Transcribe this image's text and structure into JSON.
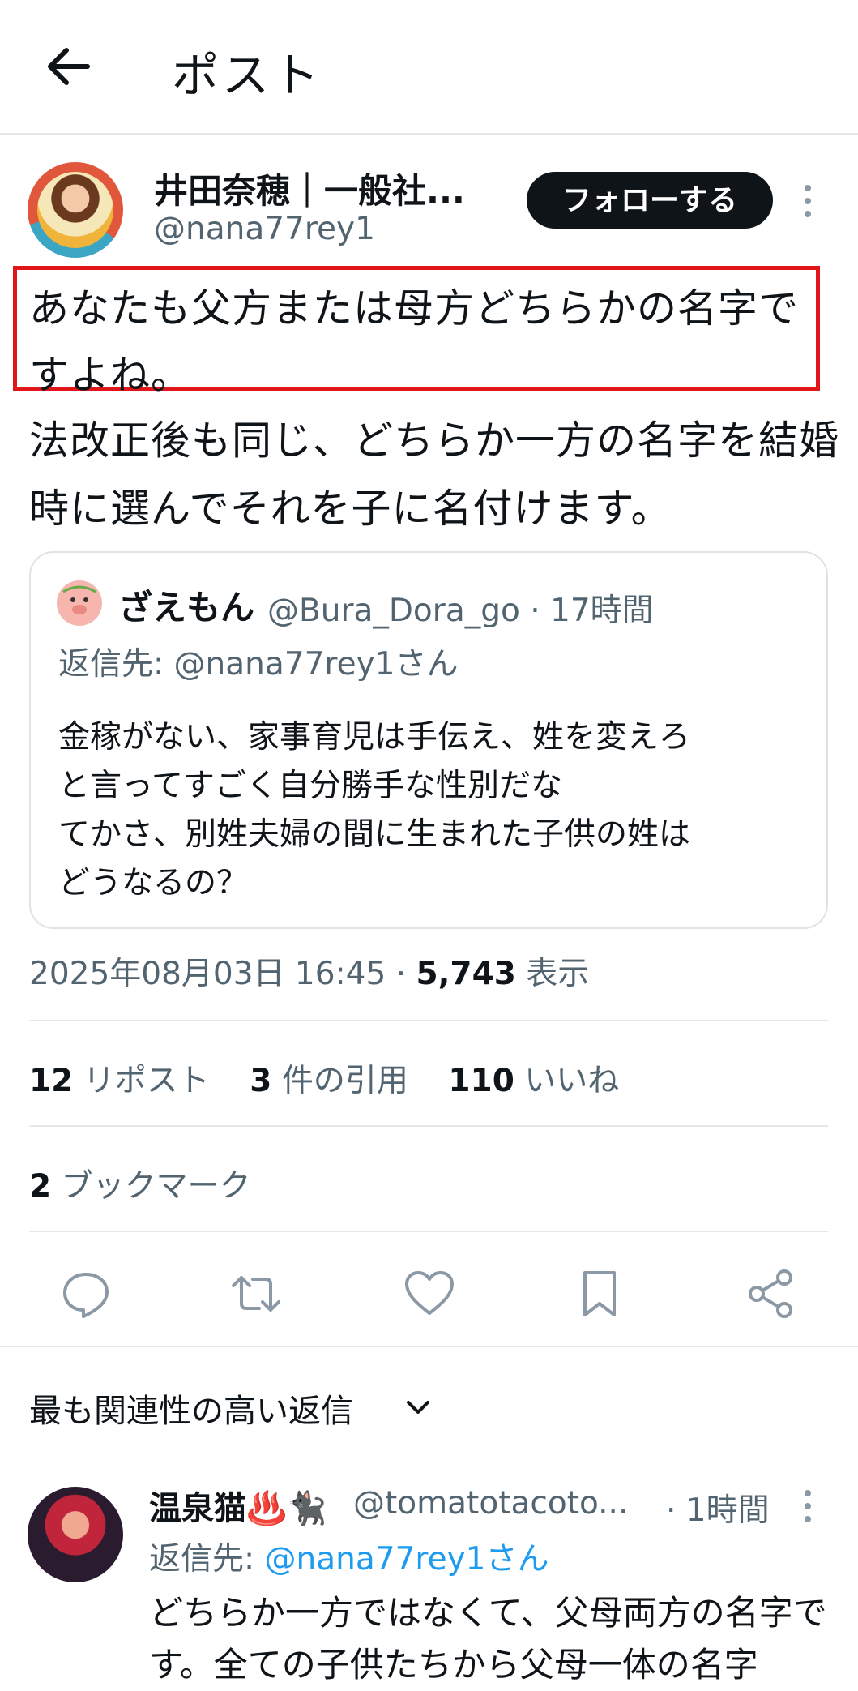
{
  "header": {
    "title": "ポスト"
  },
  "post": {
    "author_name": "井田奈穂｜一般社...",
    "author_handle": "@nana77rey1",
    "follow_label": "フォローする",
    "body_highlighted": "あなたも父方または母方どちらかの名字ですよね。",
    "body_rest": "法改正後も同じ、どちらか一方の名字を結婚時に選んでそれを子に名付けます。",
    "quote": {
      "name": "ざえもん",
      "handle_time": "@Bura_Dora_go · 17時間",
      "reply_to": "返信先: @nana77rey1さん",
      "text": "金稼がない、家事育児は手伝え、姓を変えろ\nと言ってすごく自分勝手な性別だな\nてかさ、別姓夫婦の間に生まれた子供の姓は\nどうなるの？"
    },
    "timestamp": "2025年08月03日 16:45 · ",
    "views_count": "5,743",
    "views_label": " 表示",
    "reposts_count": "12",
    "reposts_label": " リポスト",
    "quotes_count": "3",
    "quotes_label": " 件の引用",
    "likes_count": "110",
    "likes_label": " いいね",
    "bookmarks_count": "2",
    "bookmarks_label": " ブックマーク"
  },
  "actions": [
    "reply-icon",
    "repost-icon",
    "like-icon",
    "bookmark-icon",
    "share-icon"
  ],
  "replies_sort_label": "最も関連性の高い返信",
  "reply": {
    "name": "温泉猫♨️🐈‍⬛",
    "handle": "@tomatotacoto...",
    "time": "· 1時間",
    "reply_prefix": "返信先: ",
    "reply_to": "@nana77rey1さん",
    "text": "どちらか一方ではなくて、父母両方の名字です。全ての子供たちから父母一体の名字"
  },
  "colors": {
    "accent": "#1d9bf0",
    "highlight_border": "#e0161b",
    "follow_bg": "#0f1419",
    "muted": "#536471"
  }
}
